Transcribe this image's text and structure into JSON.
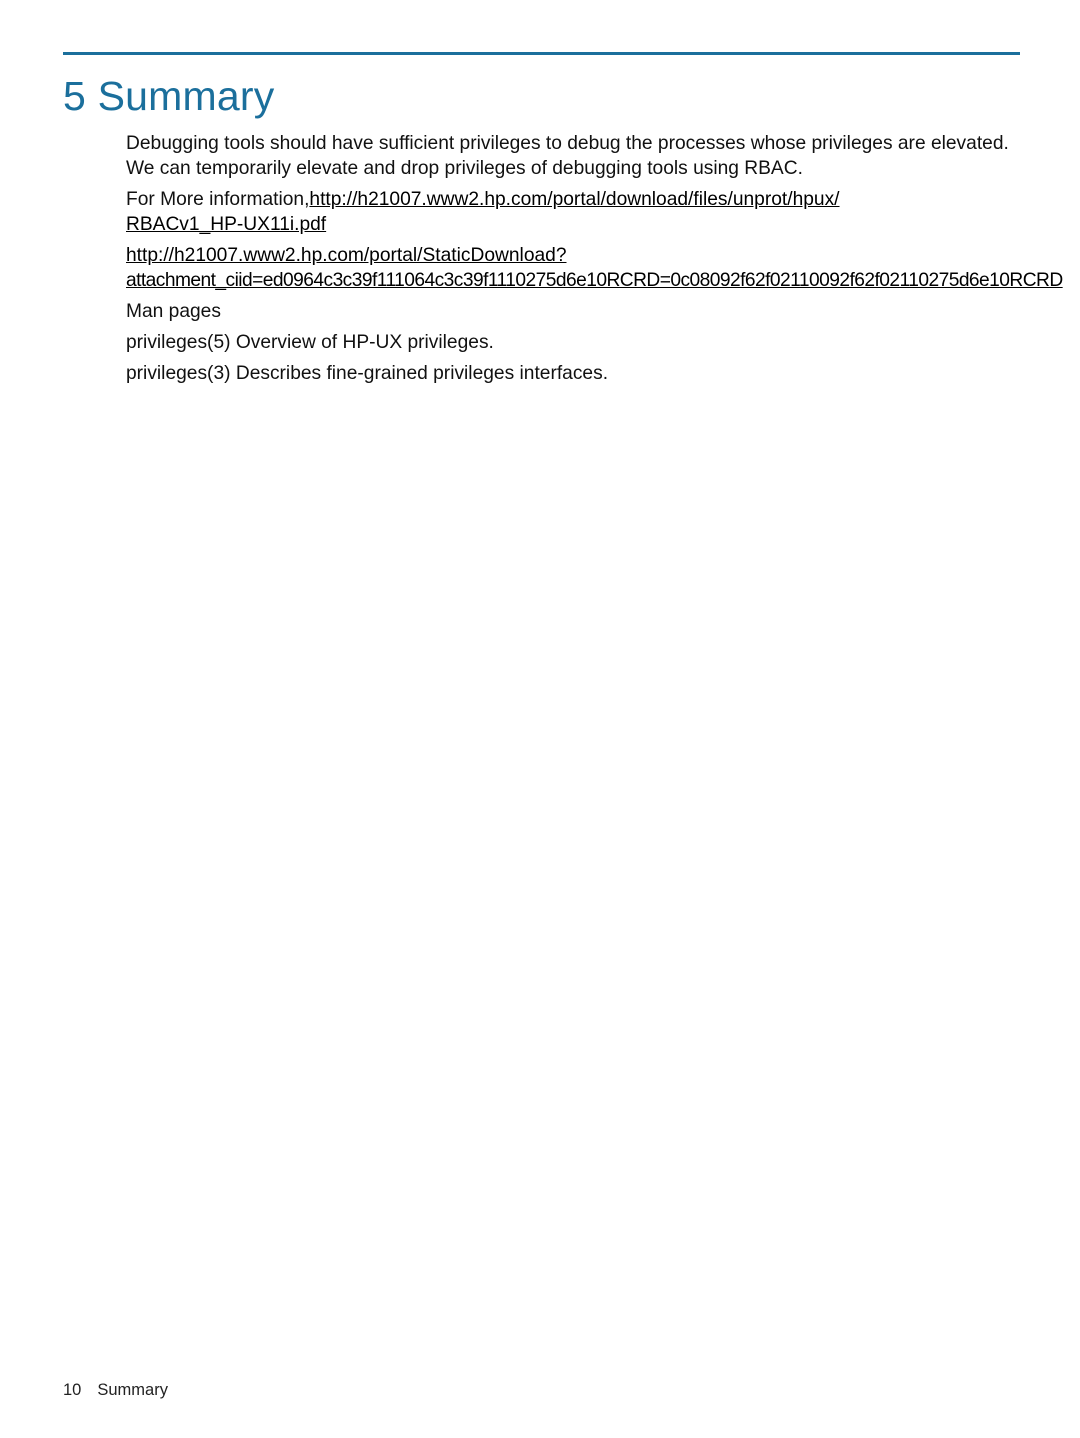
{
  "heading": "5 Summary",
  "paragraphs": {
    "p1": "Debugging tools should have sufficient privileges to debug the processes whose privileges are elevated. We can temporarily elevate and drop privileges of debugging tools using RBAC.",
    "p2_prefix": "For More information,",
    "link1a": "http://h21007.www2.hp.com/portal/download/files/unprot/hpux/",
    "link1b": "RBACv1_HP-UX11i.pdf",
    "link2a": "http://h21007.www2.hp.com/portal/StaticDownload?",
    "link2b": "attachment_ciid=ed0964c3c39f111064c3c39f1110275d6e10RCRD=0c08092f62f02110092f62f02110275d6e10RCRD",
    "man_pages_label": "Man pages",
    "man1": "privileges(5) Overview of HP-UX privileges.",
    "man2": "privileges(3) Describes fine-grained privileges interfaces."
  },
  "footer": {
    "page_number": "10",
    "section_label": "Summary"
  }
}
